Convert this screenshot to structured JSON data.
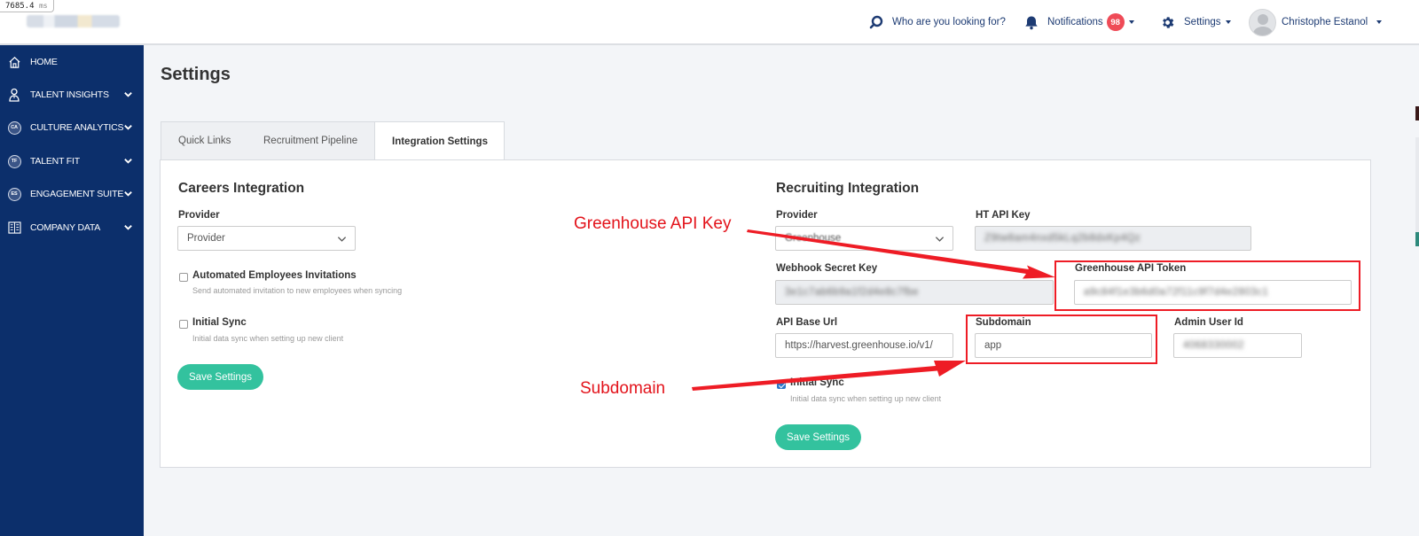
{
  "timer": {
    "value": "7685.4",
    "unit": "ms"
  },
  "topbar": {
    "search_label": "Who are you looking for?",
    "notifications_label": "Notifications",
    "notifications_count": "98",
    "settings_label": "Settings",
    "user_name": "Christophe Estanol"
  },
  "sidebar": {
    "items": [
      {
        "label": "HOME",
        "icon": "home-icon"
      },
      {
        "label": "TALENT INSIGHTS",
        "icon": "person-icon"
      },
      {
        "label": "CULTURE ANALYTICS",
        "icon": "culture-analytics-icon",
        "abbr": "CA"
      },
      {
        "label": "TALENT FIT",
        "icon": "talent-fit-icon",
        "abbr": "TF"
      },
      {
        "label": "ENGAGEMENT SUITE",
        "icon": "engagement-suite-icon",
        "abbr": "ES"
      },
      {
        "label": "COMPANY DATA",
        "icon": "building-icon"
      }
    ]
  },
  "page": {
    "title": "Settings"
  },
  "tabs": [
    {
      "label": "Quick Links",
      "active": false
    },
    {
      "label": "Recruitment Pipeline",
      "active": false
    },
    {
      "label": "Integration Settings",
      "active": true
    }
  ],
  "careers": {
    "title": "Careers Integration",
    "provider_label": "Provider",
    "provider_value": "Provider",
    "auto_invite_label": "Automated Employees Invitations",
    "auto_invite_help": "Send automated invitation to new employees when syncing",
    "initial_sync_label": "Initial Sync",
    "initial_sync_help": "Initial data sync when setting up new client",
    "save_label": "Save Settings"
  },
  "recruiting": {
    "title": "Recruiting Integration",
    "provider_label": "Provider",
    "provider_value": "Greenhouse",
    "ht_api_key_label": "HT API Key",
    "ht_api_key_value": "Z9tw8am4nxd5kLq2b8dxKp4Qz",
    "webhook_label": "Webhook Secret Key",
    "webhook_value": "3e1c7ab6b9a1f2d4e8c7fbe",
    "gh_token_label": "Greenhouse API Token",
    "gh_token_value": "a9c84f1e3b6d0a72f11c9f7d4e2803c1",
    "api_base_label": "API Base Url",
    "api_base_value": "https://harvest.greenhouse.io/v1/",
    "subdomain_label": "Subdomain",
    "subdomain_value": "app",
    "admin_user_label": "Admin User Id",
    "admin_user_value": "4068330002",
    "initial_sync_label": "Initial Sync",
    "initial_sync_help": "Initial data sync when setting up new client",
    "save_label": "Save Settings"
  },
  "annotations": {
    "api_key_note": "Greenhouse API Key",
    "subdomain_note": "Subdomain",
    "color": "#e3131b"
  },
  "colors": {
    "sidebar_bg": "#0c2f6b",
    "accent_button": "#33c29e",
    "badge": "#ef4b57",
    "nav_text": "#1d3b73"
  }
}
